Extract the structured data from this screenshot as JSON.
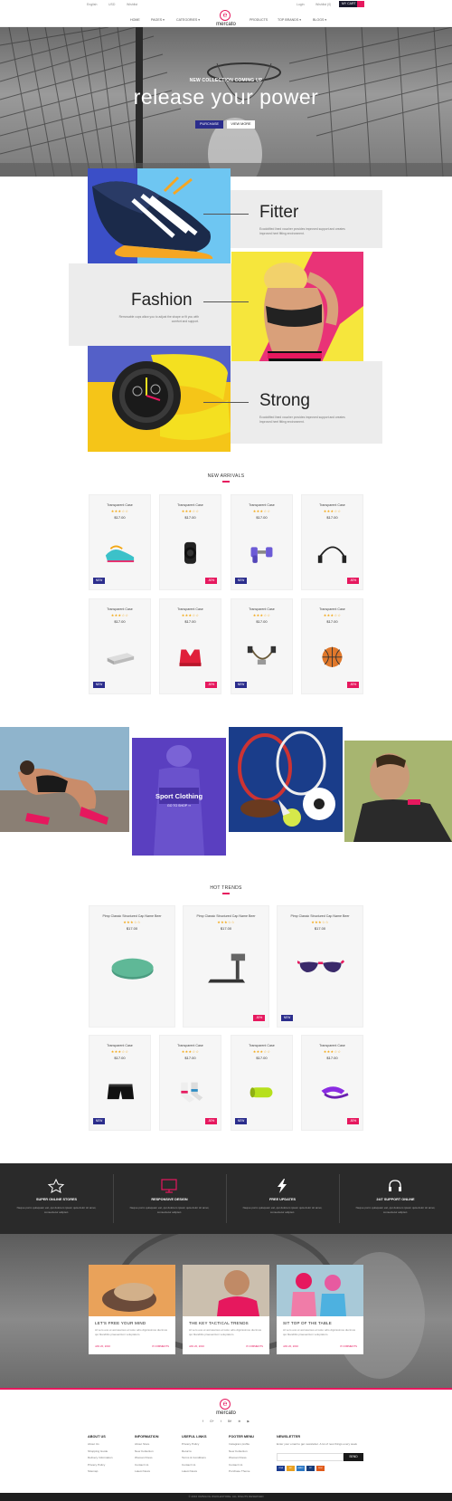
{
  "topbar": {
    "language": "English",
    "currency": "USD",
    "wishlist": "Wishlist",
    "login": "Login",
    "mycart": "Wishlist (0)",
    "cart_label": "MY CART"
  },
  "nav": {
    "logo_letter": "e",
    "logo_text": "mercato",
    "items": [
      "HOME",
      "PAGES ▾",
      "CATEGORIES ▾",
      "PRODUCTS",
      "TOP BRANDS ▾",
      "BLOGS ▾"
    ]
  },
  "hero": {
    "kicker": "NEW COLLECTION COMING UP",
    "headline": "release your power",
    "button_primary": "PURCHASE",
    "button_secondary": "VIEW MORE"
  },
  "categories": [
    {
      "title": "Fitter",
      "desc": "Ecodotified lined voucher provides improved support and creates Improved heel fitting environment."
    },
    {
      "title": "Fashion",
      "desc": "Removable cups allow you to adjust the shape or fit you with comfort and support."
    },
    {
      "title": "Strong",
      "desc": "Ecodotified lined voucher provides improved support and creates Improved heel fitting environment."
    }
  ],
  "new_arrivals": {
    "title": "NEW ARRIVALS",
    "products": [
      {
        "name": "Transparent Case",
        "stars": "★★★☆☆",
        "price": "$17.00",
        "badge": "NEW",
        "sale": "",
        "icon": "sneakers-icon"
      },
      {
        "name": "Transparent Case",
        "stars": "★★★☆☆",
        "price": "$17.00",
        "badge": "",
        "sale": "-50%",
        "icon": "smartwatch-icon"
      },
      {
        "name": "Transparent Case",
        "stars": "★★★☆☆",
        "price": "$17.00",
        "badge": "NEW",
        "sale": "",
        "icon": "dumbbells-icon"
      },
      {
        "name": "Transparent Case",
        "stars": "★★★☆☆",
        "price": "$17.00",
        "badge": "",
        "sale": "-50%",
        "icon": "jump-rope-icon"
      },
      {
        "name": "Transparent Case",
        "stars": "★★★☆☆",
        "price": "$17.00",
        "badge": "NEW",
        "sale": "",
        "icon": "powerbank-icon"
      },
      {
        "name": "Transparent Case",
        "stars": "★★★☆☆",
        "price": "$17.00",
        "badge": "",
        "sale": "-50%",
        "icon": "sports-bra-icon"
      },
      {
        "name": "Transparent Case",
        "stars": "★★★☆☆",
        "price": "$17.00",
        "badge": "NEW",
        "sale": "",
        "icon": "resistance-band-icon"
      },
      {
        "name": "Transparent Case",
        "stars": "★★★☆☆",
        "price": "$17.00",
        "badge": "",
        "sale": "-50%",
        "icon": "basketball-icon"
      }
    ]
  },
  "promo": {
    "title": "Sport Clothing",
    "link": "GO TO SHOP ➞"
  },
  "hot_trends": {
    "title": "HOT TRENDS",
    "featured": [
      {
        "name": "Pimp Classic Structured Cap Name Beer",
        "stars": "★★★☆☆",
        "price": "$17.00",
        "badge": "",
        "sale": "",
        "icon": "yoga-mat-icon"
      },
      {
        "name": "Pimp Classic Structured Cap Name Beer",
        "stars": "★★★☆☆",
        "price": "$17.00",
        "badge": "",
        "sale": "-50%",
        "icon": "treadmill-icon"
      },
      {
        "name": "Pimp Classic Structured Cap Name Beer",
        "stars": "★★★☆☆",
        "price": "$17.00",
        "badge": "NEW",
        "sale": "",
        "icon": "sunglasses-icon"
      }
    ],
    "products": [
      {
        "name": "Transparent Case",
        "stars": "★★★☆☆",
        "price": "$17.00",
        "badge": "NEW",
        "sale": "",
        "icon": "shorts-icon"
      },
      {
        "name": "Transparent Case",
        "stars": "★★★☆☆",
        "price": "$17.00",
        "badge": "",
        "sale": "-50%",
        "icon": "socks-icon"
      },
      {
        "name": "Transparent Case",
        "stars": "★★★☆☆",
        "price": "$17.00",
        "badge": "NEW",
        "sale": "",
        "icon": "foam-roller-icon"
      },
      {
        "name": "Transparent Case",
        "stars": "★★★☆☆",
        "price": "$17.00",
        "badge": "",
        "sale": "-50%",
        "icon": "visor-cap-icon"
      }
    ]
  },
  "features": [
    {
      "title": "SUPER ONLINE STORES",
      "desc": "Neque porro quisquam est, qui dolorem ipsum quia dolor sit amet, consectetur adipisci."
    },
    {
      "title": "RESPONSIVE DESIGN",
      "desc": "Neque porro quisquam est, qui dolorem ipsum quia dolor sit amet, consectetur adipisci."
    },
    {
      "title": "FREE UPDATES",
      "desc": "Neque porro quisquam est, qui dolorem ipsum quia dolor sit amet, consectetur adipisci."
    },
    {
      "title": "24/7 SUPPORT ONLINE",
      "desc": "Neque porro quisquam est, qui dolorem ipsum quia dolor sit amet, consectetur adipisci."
    }
  ],
  "blog": [
    {
      "title": "LET'S FREE YOUR MIND",
      "desc": "At vero eos et accusamus et iusto odio dignissimos ducimus qui blanditiis praesentium voluptatum.",
      "date": "JAN 20, 2016",
      "comments": "8 COMMENTS"
    },
    {
      "title": "THE KEY TACTICAL TRENDS",
      "desc": "At vero eos et accusamus et iusto odio dignissimos ducimus qui blanditiis praesentium voluptatum.",
      "date": "JAN 20, 2016",
      "comments": "8 COMMENTS"
    },
    {
      "title": "SIT TOP OF THE TABLE",
      "desc": "At vero eos et accusamus et iusto odio dignissimos ducimus qui blanditiis praesentium voluptatum.",
      "date": "JAN 20, 2016",
      "comments": "8 COMMENTS"
    }
  ],
  "footer": {
    "logo_text": "mercato",
    "social": [
      "f",
      "G+",
      "t",
      "Bē",
      "⊕",
      "▶"
    ],
    "columns": [
      {
        "title": "ABOUT US",
        "links": [
          "About Us",
          "Shopping Guide",
          "Delivery Information",
          "Privacy Policy",
          "Sitemap"
        ]
      },
      {
        "title": "INFORMATION",
        "links": [
          "About Store",
          "New Collection",
          "Woman Dress",
          "Contact Us",
          "Latest News"
        ]
      },
      {
        "title": "USEFUL LINKS",
        "links": [
          "Privacy Policy",
          "Returns",
          "Terms & Conditions",
          "Contact Us",
          "Latest News"
        ]
      },
      {
        "title": "FOOTER MENU",
        "links": [
          "Instagram profile",
          "New Collection",
          "Woman Dress",
          "Contact Us",
          "Purchase Theme"
        ]
      }
    ],
    "newsletter_title": "NEWSLETTER",
    "newsletter_desc": "Enter your email to get newsletter. A lot of new things every week",
    "newsletter_placeholder": "",
    "newsletter_button": "SEND",
    "payments": [
      "VISA",
      "MC",
      "AMEX",
      "PP",
      "DISC"
    ],
    "copyright": "© 2016 OMNILOG WHOLESTORE. ALL RIGHTS RESERVED"
  },
  "colors": {
    "accent": "#e6185e",
    "brand_blue": "#2b2d8c",
    "dark": "#2a2a2a"
  }
}
